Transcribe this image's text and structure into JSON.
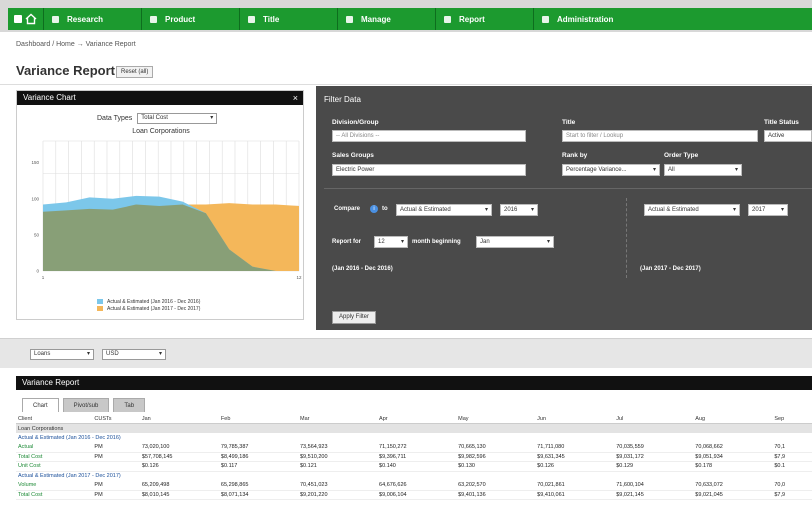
{
  "nav": {
    "items": [
      "Research",
      "Product",
      "Title",
      "Manage",
      "Report",
      "Administration"
    ]
  },
  "breadcrumb": "Dashboard / Home → Variance Report",
  "page": {
    "title": "Variance Report",
    "title_button": "Reset (all)"
  },
  "variance_chart": {
    "panel_title": "Variance Chart",
    "close": "×",
    "data_types_label": "Data Types",
    "data_types_value": "Total Cost",
    "legend": [
      "Actual & Estimated (Jan 2016 - Dec 2016)",
      "Actual & Estimated (Jan 2017 - Dec 2017)"
    ],
    "colors": {
      "s1": "#7cc7ea",
      "s2": "#f4b75a",
      "s1dark": "#8a9a6a"
    }
  },
  "chart_data": {
    "type": "area",
    "title": "Loan Corporations",
    "x": [
      1,
      2,
      3,
      4,
      5,
      6,
      7,
      8,
      9,
      10,
      11,
      12
    ],
    "ylim": [
      0,
      180
    ],
    "yticks": [
      "150",
      "100",
      "50",
      "0"
    ],
    "xticks": [
      "1",
      "",
      "",
      "",
      "",
      "",
      "",
      "",
      "",
      "",
      "",
      "12"
    ],
    "series": [
      {
        "name": "Actual & Estimated (Jan 2016 - Dec 2016)",
        "values": [
          92,
          95,
          102,
          100,
          104,
          103,
          96,
          80,
          30,
          6,
          0,
          0
        ]
      },
      {
        "name": "Actual & Estimated (Jan 2017 - Dec 2017)",
        "values": [
          82,
          84,
          86,
          85,
          92,
          90,
          92,
          92,
          94,
          92,
          92,
          90
        ]
      }
    ],
    "grid": true
  },
  "filter": {
    "title": "Filter Data",
    "lbl_division": "Division/Group",
    "in_division": "-- All Divisions --",
    "lbl_title": "Title",
    "in_title": "Start to filter / Lookup",
    "lbl_status": "Title Status",
    "in_status": "Active",
    "lbl_sales": "Sales Groups",
    "in_sales": "Electric Power",
    "lbl_rank": "Rank by",
    "in_rank": "Percentage Variance...",
    "lbl_order": "Order Type",
    "in_order": "All",
    "lbl_compare": "Compare",
    "compare_to": "to",
    "cmp1": "Actual & Estimated",
    "year1": "2016",
    "cmp2": "Actual & Estimated",
    "year2": "2017",
    "lbl_report": "Report for",
    "months": "12",
    "lbl_months": "month beginning",
    "begin": "Jan",
    "range1": "(Jan 2016 - Dec 2016)",
    "range2": "(Jan 2017 - Dec 2017)",
    "apply": "Apply Filter"
  },
  "strip": {
    "sel1": "Loans",
    "sel2": "USD"
  },
  "report": {
    "title": "Variance Report",
    "tabs": [
      "Chart",
      "Pivot/sub",
      "Tab"
    ],
    "columns": [
      "Client",
      "CUSTs",
      "Jan",
      "Feb",
      "Mar",
      "Apr",
      "May",
      "Jun",
      "Jul",
      "Aug",
      "Sep"
    ],
    "group": "Loan Corporations",
    "sub1": "Actual & Estimated (Jan 2016 - Dec 2016)",
    "rows1": [
      [
        "Actual",
        "PM",
        "73,020,100",
        "79,785,387",
        "73,564,923",
        "71,150,272",
        "70,665,130",
        "71,711,080",
        "70,035,559",
        "70,068,662",
        "70,1"
      ],
      [
        "Total Cost",
        "PM",
        "$57,708,145",
        "$8,499,186",
        "$9,510,200",
        "$9,396,711",
        "$9,982,596",
        "$9,631,345",
        "$9,031,172",
        "$9,051,934",
        "$7,9"
      ],
      [
        "Unit Cost",
        "",
        "$0.126",
        "$0.117",
        "$0.121",
        "$0.140",
        "$0.130",
        "$0.126",
        "$0.129",
        "$0.178",
        "$0.1"
      ]
    ],
    "sub2": "Actual & Estimated (Jan 2017 - Dec 2017)",
    "rows2": [
      [
        "Volume",
        "PM",
        "65,209,498",
        "65,298,865",
        "70,451,023",
        "64,676,626",
        "63,202,570",
        "70,021,861",
        "71,600,104",
        "70,633,072",
        "70,0"
      ],
      [
        "Total Cost",
        "PM",
        "$8,010,145",
        "$8,071,134",
        "$9,201,220",
        "$9,006,104",
        "$9,401,136",
        "$9,410,061",
        "$9,021,145",
        "$9,021,045",
        "$7,9"
      ]
    ]
  }
}
